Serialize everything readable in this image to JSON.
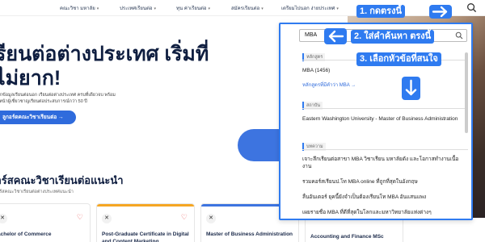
{
  "nav": {
    "items": [
      {
        "label": "คณะวิชา มหาลัย"
      },
      {
        "label": "ประเทศเรียนต่อ"
      },
      {
        "label": "ทุน ค่าเรียนต่อ"
      },
      {
        "label": "สมัครเรียนต่อ"
      },
      {
        "label": "เตรียมไปนอก ง่ายประเทศ"
      }
    ]
  },
  "hero": {
    "title_line1": "รียนต่อต่างประเทศ เริ่มที่",
    "title_line2": "ไม่ยาก!",
    "sub_line1": "ทุกข้อมูลเรียนต่อนอก เรียนต่อต่างประเทศ ครบที่เดียวจบ พร้อม",
    "sub_line2": "าหน้าผู้เชี่ยวชาญเรียนต่อประสบการณ์กว่า 50 ปี",
    "button": "ลูกอร์ดคณะวิชาเรียนต่อ →"
  },
  "courses": {
    "title": "อร์สคณะวิชาเรียนต่อแนะนำ",
    "subtitle": "อร์สคณะวิชาเรียนต่อต่างประเทศแนะนำ",
    "cards": [
      {
        "title": "achelor of Commerce",
        "bar_color": "#ffffff"
      },
      {
        "title": "Post-Graduate Certificate in Digital and Content Marketing",
        "bar_color": "#f5a623"
      },
      {
        "title": "Master of Business Administration",
        "bar_color": "#3d74e0"
      },
      {
        "title": "Accounting and Finance MSc",
        "bar_color": "#ffffff"
      }
    ]
  },
  "search": {
    "query": "MBA",
    "sections": [
      {
        "label": "หลักสูตร"
      },
      {
        "label": "สถาบัน"
      },
      {
        "label": "บทความ"
      }
    ],
    "course_result": "MBA (1456)",
    "course_more": "หลักสูตรที่มีคำว่า MBA →",
    "institute_result": "Eastern Washington University - Master of Business Administration",
    "articles": [
      "เจาะลึกเรียนต่อสาขา MBA วิชาเรียน มหาลัยดัง และโอกาสทำงานเนื้องาน",
      "รวมคอร์สเรียนป.โท MBA online ที่ถูกที่สุดในอังกฤษ",
      "ลื่นอันเดอร์ ยุคนี้ยังจำเป็นต้องเรียนโท MBA อันแสนแพง",
      "เผยรายชื่อ MBA ที่ดีที่สุดในโลกและมหาวิทยาลัยแห่งต่างๆ"
    ]
  },
  "annotations": {
    "step1": "1. กดตรงนี้",
    "step2": "2. ใส่คำค้นหา ตรงนี้",
    "step3": "3. เลือกหัวข้อที่สนใจ"
  },
  "colors": {
    "accent": "#2f7bf0",
    "brand_blue": "#2f6bdc",
    "heart": "#e64b4b"
  },
  "icons": [
    "search-icon",
    "arrow-right-icon",
    "arrow-left-icon",
    "arrow-down-icon",
    "close-icon",
    "heart-icon",
    "chevron-down-icon"
  ]
}
